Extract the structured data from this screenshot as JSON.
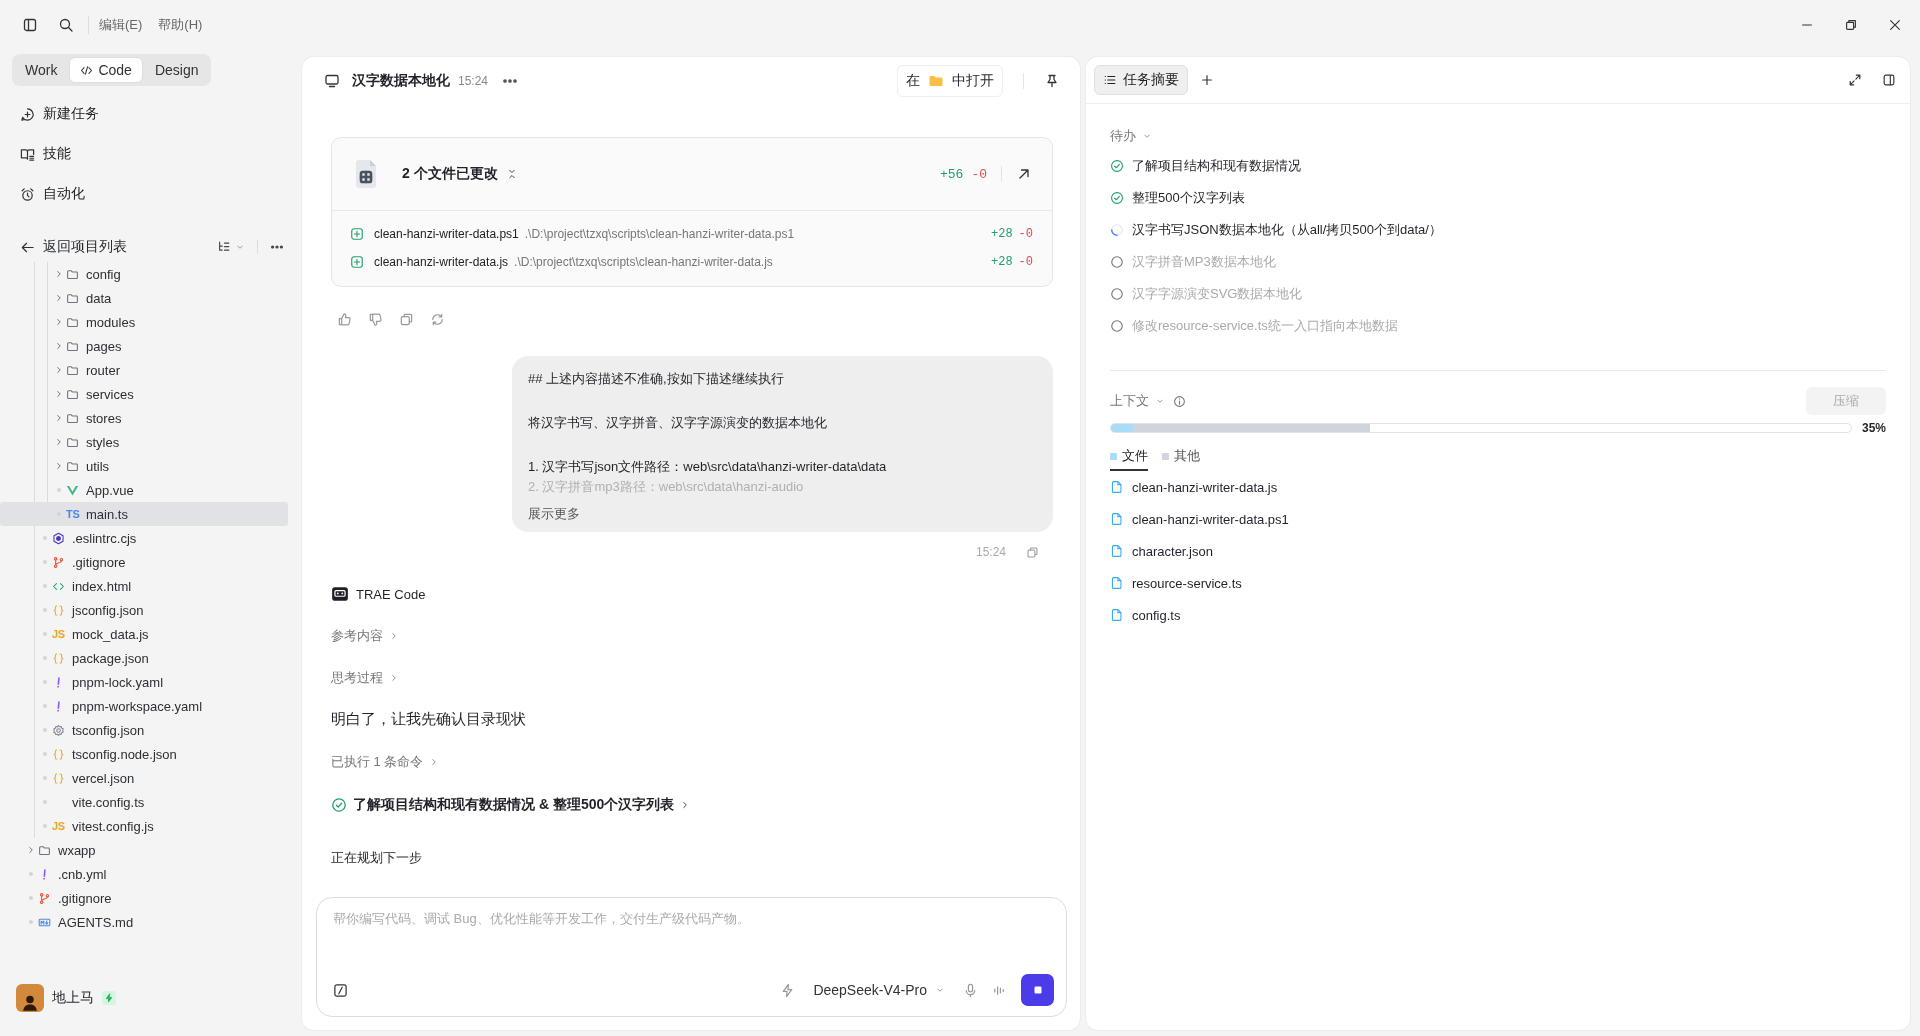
{
  "menu_bar": {
    "items": [
      "编辑(E)",
      "帮助(H)"
    ]
  },
  "mode_tabs": [
    {
      "label": "Work",
      "selected": false,
      "has_icon": false
    },
    {
      "label": "Code",
      "selected": true,
      "has_icon": true
    },
    {
      "label": "Design",
      "selected": false,
      "has_icon": false
    }
  ],
  "nav": [
    {
      "label": "新建任务",
      "kind": "new-task"
    },
    {
      "label": "技能",
      "kind": "skills"
    },
    {
      "label": "自动化",
      "kind": "automation"
    }
  ],
  "project": {
    "back_label": "返回项目列表"
  },
  "file_tree": [
    {
      "children": [
        {
          "children": [
            {
              "name": "config",
              "kind": "folder",
              "expanded": false,
              "selected": false
            },
            {
              "name": "data",
              "kind": "folder",
              "expanded": false,
              "selected": false
            },
            {
              "name": "modules",
              "kind": "folder",
              "expanded": false,
              "selected": false
            },
            {
              "name": "pages",
              "kind": "folder",
              "expanded": false,
              "selected": false
            },
            {
              "name": "router",
              "kind": "folder",
              "expanded": false,
              "selected": false
            },
            {
              "name": "services",
              "kind": "folder",
              "expanded": false,
              "selected": false
            },
            {
              "name": "stores",
              "kind": "folder",
              "expanded": false,
              "selected": false
            },
            {
              "name": "styles",
              "kind": "folder",
              "expanded": false,
              "selected": false
            },
            {
              "name": "utils",
              "kind": "folder",
              "expanded": false,
              "selected": false
            },
            {
              "name": "App.vue",
              "kind": "vue",
              "selected": false
            },
            {
              "name": "main.ts",
              "kind": "badge",
              "badge": "TS",
              "selected": true
            }
          ]
        },
        {
          "name": ".eslintrc.cjs",
          "kind": "eslint",
          "selected": false
        },
        {
          "name": ".gitignore",
          "kind": "git",
          "selected": false
        },
        {
          "name": "index.html",
          "kind": "html",
          "selected": false
        },
        {
          "name": "jsconfig.json",
          "kind": "json",
          "selected": false
        },
        {
          "name": "mock_data.js",
          "kind": "badge",
          "badge": "JS",
          "selected": false
        },
        {
          "name": "package.json",
          "kind": "json",
          "selected": false
        },
        {
          "name": "pnpm-lock.yaml",
          "kind": "yaml",
          "selected": false
        },
        {
          "name": "pnpm-workspace.yaml",
          "kind": "yaml",
          "selected": false
        },
        {
          "name": "tsconfig.json",
          "kind": "settings",
          "selected": false
        },
        {
          "name": "tsconfig.node.json",
          "kind": "json",
          "selected": false
        },
        {
          "name": "vercel.json",
          "kind": "json",
          "selected": false
        },
        {
          "name": "vite.config.ts",
          "kind": "plain",
          "selected": false
        },
        {
          "name": "vitest.config.js",
          "kind": "badge",
          "badge": "JS",
          "selected": false
        }
      ]
    },
    {
      "name": "wxapp",
      "kind": "folder",
      "expanded": false,
      "selected": false
    },
    {
      "name": ".cnb.yml",
      "kind": "yaml",
      "selected": false
    },
    {
      "name": ".gitignore",
      "kind": "git",
      "selected": false
    },
    {
      "name": "AGENTS.md",
      "kind": "markdown",
      "selected": false
    }
  ],
  "user": {
    "name": "地上马"
  },
  "conversation": {
    "title": "汉字数据本地化",
    "time": "15:24",
    "open_in": {
      "before": "在",
      "after": "中打开"
    }
  },
  "changes": {
    "title": "2 个文件已更改",
    "added": "+56",
    "removed": "-0",
    "files": [
      {
        "name": "clean-hanzi-writer-data.ps1",
        "path": ".\\D:\\project\\tzxq\\scripts\\clean-hanzi-writer-data.ps1",
        "added": "+28",
        "removed": "-0"
      },
      {
        "name": "clean-hanzi-writer-data.js",
        "path": ".\\D:\\project\\tzxq\\scripts\\clean-hanzi-writer-data.js",
        "added": "+28",
        "removed": "-0"
      }
    ]
  },
  "user_message": {
    "lines": [
      {
        "text": "## 上述内容描述不准确,按如下描述继续执行",
        "kind": "paragraph",
        "faded": false
      },
      {
        "text": "将汉字书写、汉字拼音、汉字字源演变的数据本地化",
        "kind": "paragraph",
        "faded": false
      },
      {
        "text": "1. 汉字书写json文件路径：web\\src\\data\\hanzi-writer-data\\data",
        "kind": "list",
        "faded": false
      },
      {
        "text": "2. 汉字拼音mp3路径：web\\src\\data\\hanzi-audio",
        "kind": "list",
        "faded": true
      }
    ],
    "more": "展示更多",
    "time": "15:24"
  },
  "assistant": {
    "name": "TRAE Code",
    "steps": [
      {
        "kind": "collapsible",
        "label": "参考内容"
      },
      {
        "kind": "collapsible",
        "label": "思考过程"
      },
      {
        "kind": "text",
        "label": "明白了，让我先确认目录现状"
      },
      {
        "kind": "collapsible",
        "label": "已执行 1 条命令"
      },
      {
        "kind": "task",
        "label": "了解项目结构和现有数据情况 & 整理500个汉字列表"
      },
      {
        "kind": "status",
        "label": "正在规划下一步"
      }
    ]
  },
  "composer": {
    "placeholder": "帮你编写代码、调试 Bug、优化性能等开发工作，交付生产级代码产物。",
    "model": "DeepSeek-V4-Pro"
  },
  "summary": {
    "tabs": [
      {
        "label": "任务摘要",
        "selected": true
      }
    ],
    "todo": {
      "title": "待办",
      "expanded": true,
      "items": [
        {
          "label": "了解项目结构和现有数据情况",
          "kind": "done"
        },
        {
          "label": "整理500个汉字列表",
          "kind": "done"
        },
        {
          "label": "汉字书写JSON数据本地化（从all/拷贝500个到data/）",
          "kind": "running"
        },
        {
          "label": "汉字拼音MP3数据本地化",
          "kind": "pending"
        },
        {
          "label": "汉字字源演变SVG数据本地化",
          "kind": "pending"
        },
        {
          "label": "修改resource-service.ts统一入口指向本地数据",
          "kind": "pending"
        }
      ]
    },
    "context": {
      "title": "上下文",
      "expanded": true,
      "compress": "压缩",
      "level": 0.35,
      "reading": "35%",
      "segments": [
        {
          "label": "文件",
          "level": 0.03,
          "color": "#a8def5",
          "selected": true
        },
        {
          "label": "其他",
          "color": "#d0d4db",
          "selected": false
        }
      ],
      "files": [
        "clean-hanzi-writer-data.js",
        "clean-hanzi-writer-data.ps1",
        "character.json",
        "resource-service.ts",
        "config.ts"
      ]
    }
  }
}
